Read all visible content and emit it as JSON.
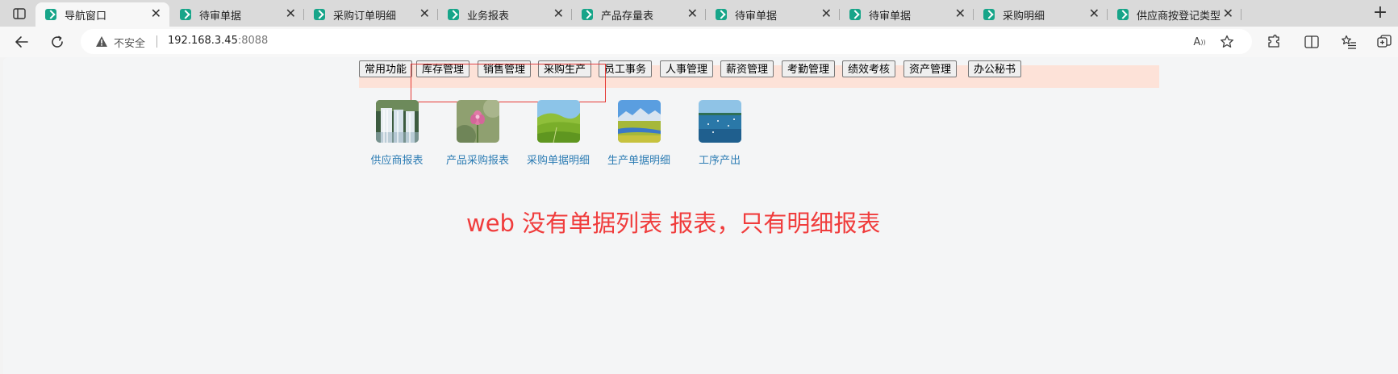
{
  "browser": {
    "tabs": [
      {
        "title": "导航窗口",
        "active": true
      },
      {
        "title": "待审单据",
        "active": false
      },
      {
        "title": "采购订单明细",
        "active": false
      },
      {
        "title": "业务报表",
        "active": false
      },
      {
        "title": "产品存量表",
        "active": false
      },
      {
        "title": "待审单据",
        "active": false
      },
      {
        "title": "待审单据",
        "active": false
      },
      {
        "title": "采购明细",
        "active": false
      },
      {
        "title": "供应商按登记类型",
        "active": false
      }
    ],
    "close_glyph": "✕",
    "new_tab_glyph": "+",
    "address": {
      "security_label": "不安全",
      "host": "192.168.3.45",
      "port": ":8088"
    },
    "read_aloud_glyph": "A",
    "icons": [
      "sidebar-toggle-icon",
      "back-arrow-icon",
      "reload-icon",
      "warning-icon",
      "read-aloud-icon",
      "favorite-star-icon",
      "extensions-icon",
      "split-screen-icon",
      "favorites-list-icon",
      "collections-icon"
    ]
  },
  "app": {
    "menu": [
      "常用功能",
      "库存管理",
      "销售管理",
      "采购生产",
      "员工事务",
      "人事管理",
      "薪资管理",
      "考勤管理",
      "绩效考核",
      "资产管理",
      "办公秘书"
    ],
    "tiles": [
      {
        "label": "供应商报表",
        "image": "waterfall"
      },
      {
        "label": "产品采购报表",
        "image": "pink-flower"
      },
      {
        "label": "采购单据明细",
        "image": "green-hills"
      },
      {
        "label": "生产单据明细",
        "image": "mountain-river"
      },
      {
        "label": "工序产出",
        "image": "lake-birds"
      }
    ],
    "note": "web 没有单据列表 报表，只有明细报表"
  },
  "colors": {
    "menubar_bg": "#fde2d8",
    "highlight_border": "#e53935",
    "tile_label": "#2e7db4",
    "note_text": "#f03c3c"
  }
}
